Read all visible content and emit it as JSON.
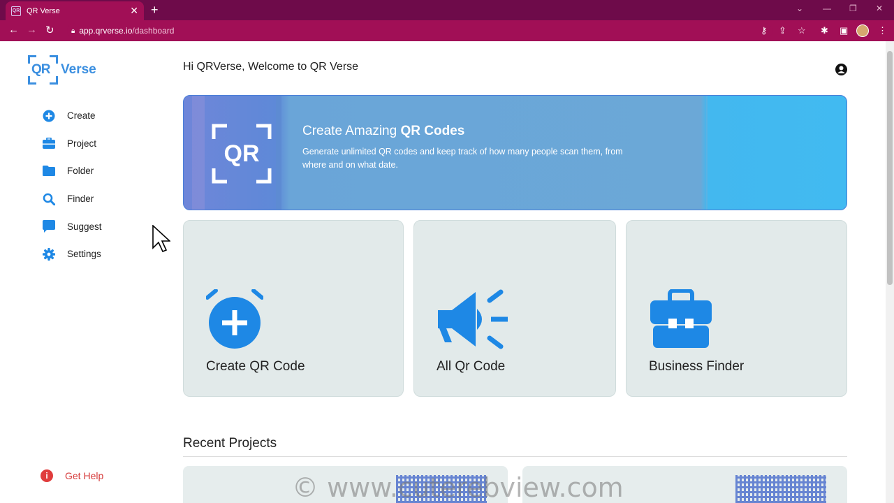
{
  "browser": {
    "tab_title": "QR Verse",
    "url_domain": "app.qrverse.io",
    "url_path": "/dashboard",
    "accent": "#a10f56"
  },
  "brand": {
    "mark": "QR",
    "name": "Verse",
    "color": "#3b8fe0"
  },
  "sidebar": {
    "items": [
      {
        "label": "Create",
        "icon": "plus-circle-icon"
      },
      {
        "label": "Project",
        "icon": "briefcase-icon"
      },
      {
        "label": "Folder",
        "icon": "folder-icon"
      },
      {
        "label": "Finder",
        "icon": "search-icon"
      },
      {
        "label": "Suggest",
        "icon": "comment-icon"
      },
      {
        "label": "Settings",
        "icon": "gear-icon"
      }
    ],
    "help_label": "Get Help"
  },
  "header": {
    "welcome": "Hi QRVerse, Welcome to QR Verse"
  },
  "banner": {
    "title_prefix": "Create Amazing",
    "title_bold": "QR Codes",
    "subtitle": "Generate unlimited QR codes and keep track of how many people scan them, from where and on what date.",
    "icon_text": "QR"
  },
  "cards": [
    {
      "label": "Create QR Code",
      "icon": "alarm-plus-icon"
    },
    {
      "label": "All Qr Code",
      "icon": "megaphone-icon"
    },
    {
      "label": "Business Finder",
      "icon": "toolbox-icon"
    }
  ],
  "recent": {
    "title": "Recent Projects"
  },
  "watermark": "© www.cuterebview.com"
}
